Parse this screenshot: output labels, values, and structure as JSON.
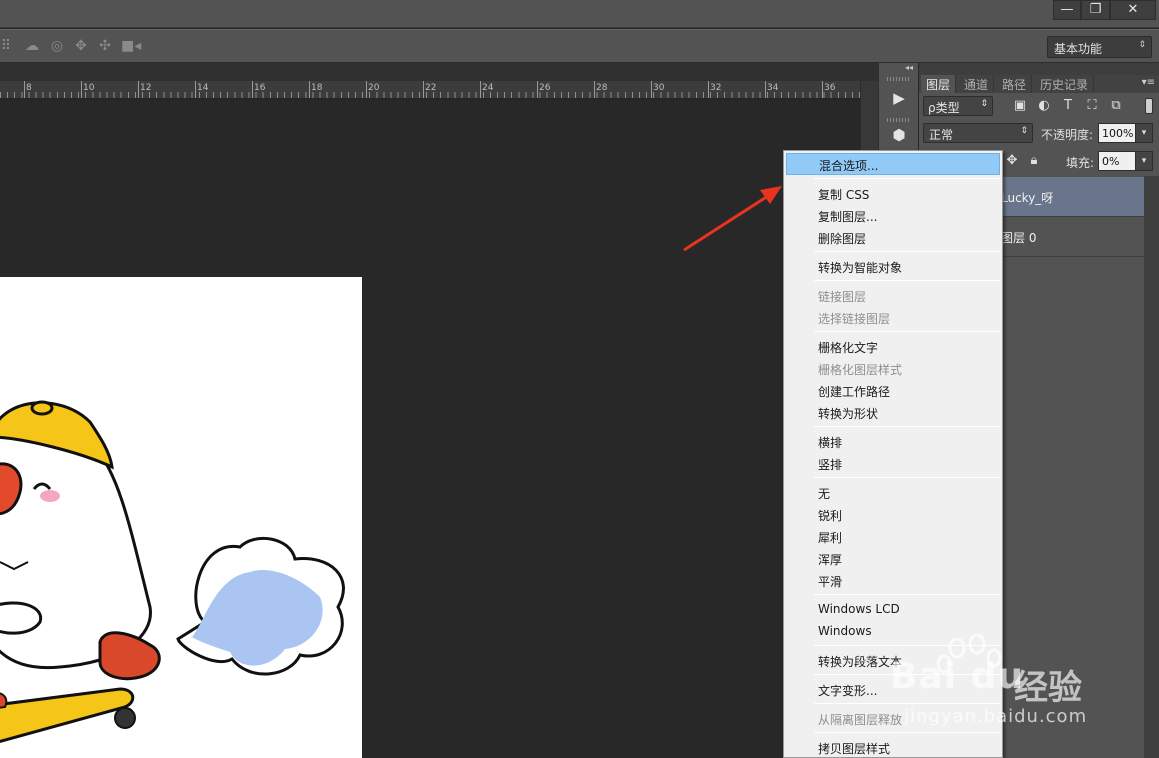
{
  "window": {
    "controls": {
      "minimize": "—",
      "restore": "❐",
      "close": "✕"
    }
  },
  "options_bar": {
    "icons": [
      "orbit-3d-icon",
      "rotate-3d-icon",
      "pan-3d-icon",
      "slide-3d-icon",
      "scale-3d-video-icon"
    ],
    "workspace_label": "基本功能"
  },
  "ruler": {
    "labels": [
      "8",
      "10",
      "12",
      "14",
      "16",
      "18",
      "20",
      "22",
      "24",
      "26",
      "28",
      "30",
      "32",
      "34",
      "36"
    ]
  },
  "layers_panel": {
    "tabs": [
      "图层",
      "通道",
      "路径",
      "历史记录"
    ],
    "active_tab": "图层",
    "kind_filter": "ρ类型",
    "blend_mode": "正常",
    "opacity_label": "不透明度:",
    "opacity_value": "100%",
    "fill_label": "填充:",
    "fill_value": "0%",
    "layers": [
      {
        "name": "Lucky_呀",
        "selected": true
      },
      {
        "name": "图层 0",
        "selected": false
      }
    ]
  },
  "context_menu": {
    "items": [
      {
        "label": "混合选项...",
        "disabled": false,
        "highlighted": true
      },
      {
        "label": "复制 CSS",
        "disabled": false
      },
      {
        "label": "复制图层...",
        "disabled": false
      },
      {
        "label": "删除图层",
        "disabled": false
      },
      {
        "label": "转换为智能对象",
        "disabled": false
      },
      {
        "label": "链接图层",
        "disabled": true
      },
      {
        "label": "选择链接图层",
        "disabled": true
      },
      {
        "label": "栅格化文字",
        "disabled": false
      },
      {
        "label": "栅格化图层样式",
        "disabled": true
      },
      {
        "label": "创建工作路径",
        "disabled": false
      },
      {
        "label": "转换为形状",
        "disabled": false
      },
      {
        "label": "横排",
        "disabled": false
      },
      {
        "label": "竖排",
        "disabled": false
      },
      {
        "label": "无",
        "disabled": false
      },
      {
        "label": "锐利",
        "disabled": false
      },
      {
        "label": "犀利",
        "disabled": false
      },
      {
        "label": "浑厚",
        "disabled": false
      },
      {
        "label": "平滑",
        "disabled": false
      },
      {
        "label": "Windows LCD",
        "disabled": false
      },
      {
        "label": "Windows",
        "disabled": false
      },
      {
        "label": "转换为段落文本",
        "disabled": false
      },
      {
        "label": "文字变形...",
        "disabled": false
      },
      {
        "label": "从隔离图层释放",
        "disabled": true
      },
      {
        "label": "拷贝图层样式",
        "disabled": false
      }
    ]
  },
  "watermark": {
    "brand": "Bai du",
    "brand_cn": "经验",
    "url": "jingyan.baidu.com"
  },
  "colors": {
    "menu_highlight": "#91c9f7",
    "arrow": "#e8341f",
    "layer_selected": "#69758a"
  }
}
